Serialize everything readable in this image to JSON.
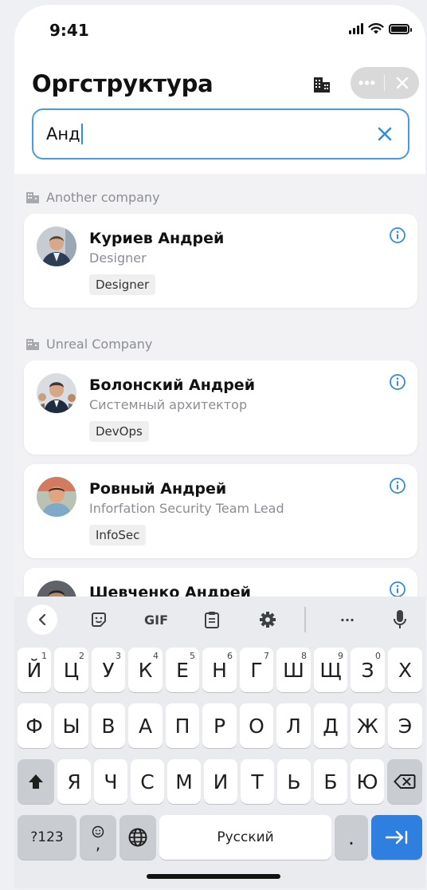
{
  "status_bar": {
    "time": "9:41"
  },
  "header": {
    "title": "Оргструктура",
    "building_icon": "building-icon",
    "more_icon": "more-dots-icon",
    "close_icon": "close-icon"
  },
  "search": {
    "value": "Анд",
    "clear_icon": "clear-x-icon"
  },
  "groups": [
    {
      "name": "Another company",
      "people": [
        {
          "name": "Куриев Андрей",
          "role": "Designer",
          "tag": "Designer"
        }
      ]
    },
    {
      "name": "Unreal Company",
      "people": [
        {
          "name": "Болонский Андрей",
          "role": "Системный архитектор",
          "tag": "DevOps"
        },
        {
          "name": "Ровный Андрей",
          "role": "Inforfation Security Team Lead",
          "tag": "InfoSec"
        },
        {
          "name": "Шевченко Андрей",
          "role": "",
          "tag": ""
        }
      ]
    }
  ],
  "keyboard": {
    "toolbar": {
      "gif_label": "GIF",
      "more_label": "···"
    },
    "row1": [
      {
        "label": "Й",
        "sup": "1"
      },
      {
        "label": "Ц",
        "sup": "2"
      },
      {
        "label": "У",
        "sup": "3"
      },
      {
        "label": "К",
        "sup": "4"
      },
      {
        "label": "Е",
        "sup": "5"
      },
      {
        "label": "Н",
        "sup": "6"
      },
      {
        "label": "Г",
        "sup": "7"
      },
      {
        "label": "Ш",
        "sup": "8"
      },
      {
        "label": "Щ",
        "sup": "9"
      },
      {
        "label": "З",
        "sup": "0"
      },
      {
        "label": "Х",
        "sup": ""
      }
    ],
    "row2": [
      "Ф",
      "Ы",
      "В",
      "А",
      "П",
      "Р",
      "О",
      "Л",
      "Д",
      "Ж",
      "Э"
    ],
    "row3": [
      "Я",
      "Ч",
      "С",
      "М",
      "И",
      "Т",
      "Ь",
      "Б",
      "Ю"
    ],
    "symbols_label": "?123",
    "emoji_comma_label": ",",
    "space_label": "Русский",
    "period_label": "."
  }
}
